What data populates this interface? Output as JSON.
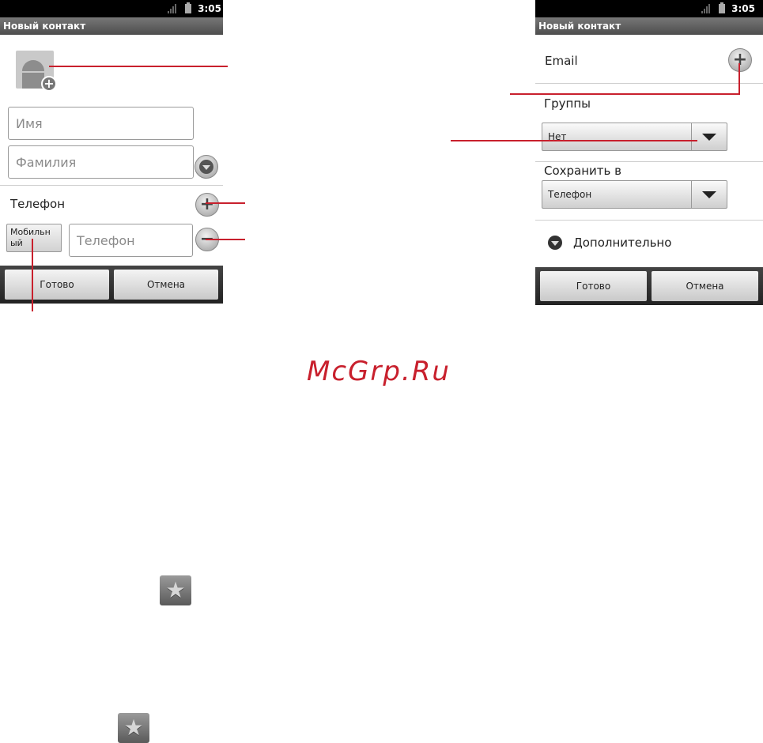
{
  "status_bar": {
    "time": "3:05"
  },
  "left_screen": {
    "title": "Новый контакт",
    "first_name_placeholder": "Имя",
    "last_name_placeholder": "Фамилия",
    "phone_section_label": "Телефон",
    "phone_type_label": "Мобильный",
    "phone_type_line1": "Мобильн",
    "phone_type_line2": "ый",
    "phone_placeholder": "Телефон",
    "done_label": "Готово",
    "cancel_label": "Отмена"
  },
  "right_screen": {
    "title": "Новый контакт",
    "email_label": "Email",
    "groups_label": "Группы",
    "groups_value": "Нет",
    "save_to_label": "Сохранить в",
    "save_to_value": "Телефон",
    "more_label": "Дополнительно",
    "done_label": "Готово",
    "cancel_label": "Отмена"
  },
  "watermark": "McGrp.Ru",
  "colors": {
    "callout": "#c8202d",
    "watermark": "#c8202d"
  },
  "icons": [
    "star-icon",
    "star-icon"
  ]
}
